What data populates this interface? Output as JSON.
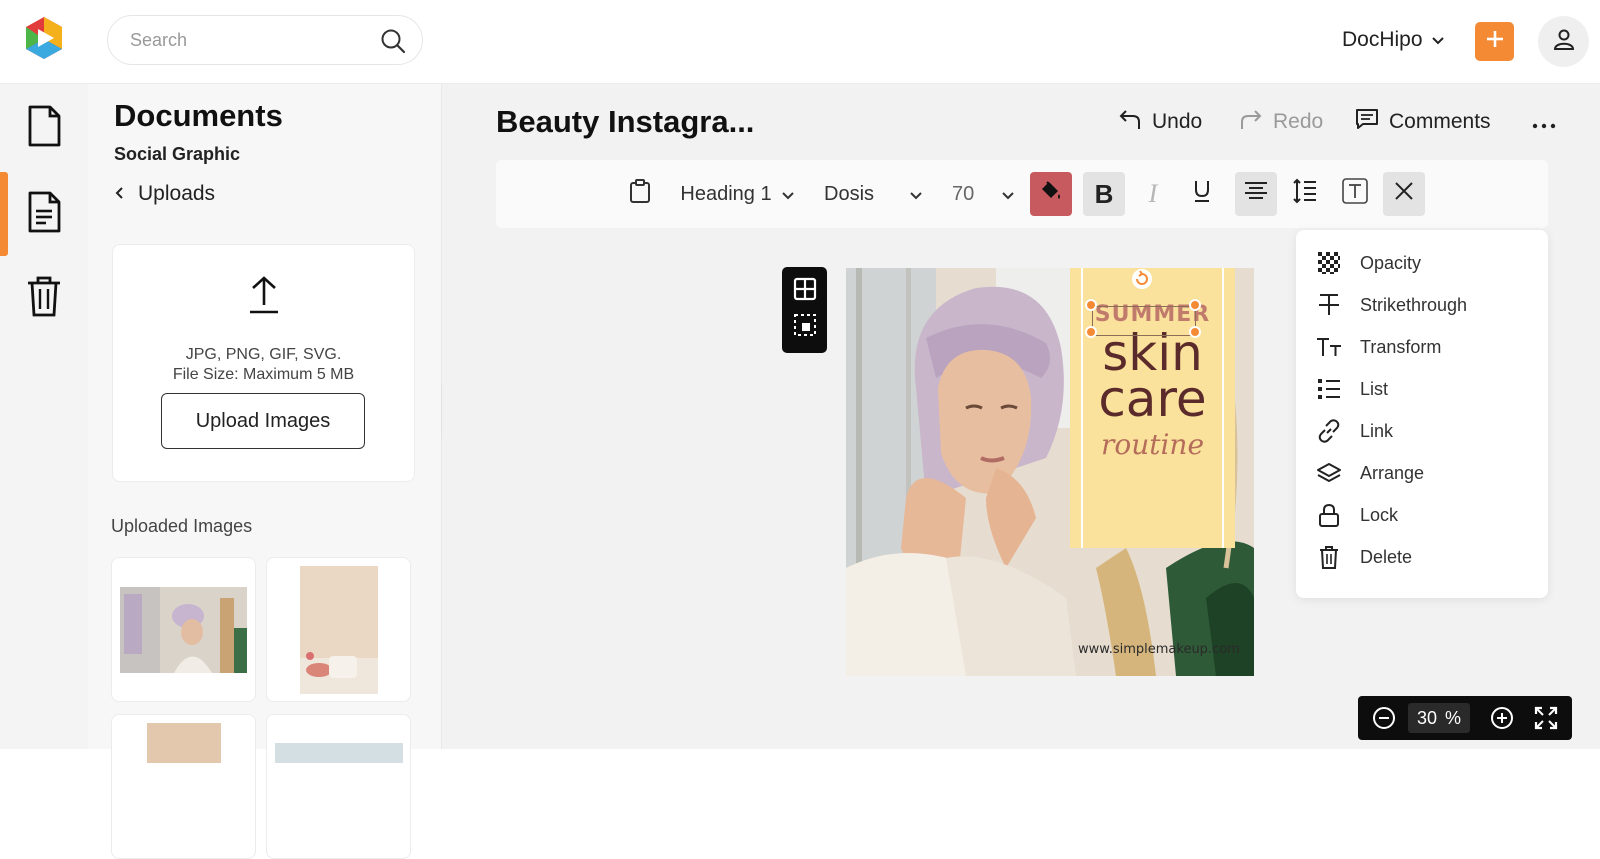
{
  "header": {
    "search_placeholder": "Search",
    "workspace_label": "DocHipo",
    "accent_color": "#f58a34"
  },
  "rail": {
    "items": [
      {
        "icon": "document-icon"
      },
      {
        "icon": "documents-list-icon",
        "active": true
      },
      {
        "icon": "trash-icon"
      }
    ]
  },
  "panel": {
    "title": "Documents",
    "subtitle": "Social Graphic",
    "back_label": "Uploads",
    "upload_formats": "JPG, PNG, GIF, SVG.",
    "upload_size": "File Size: Maximum 5 MB",
    "upload_button": "Upload Images",
    "uploaded_label": "Uploaded Images"
  },
  "editor": {
    "doc_title": "Beauty Instagra...",
    "undo_label": "Undo",
    "redo_label": "Redo",
    "comments_label": "Comments",
    "toolbar": {
      "text_style": "Heading 1",
      "font": "Dosis",
      "font_size": "70",
      "text_color": "#c75a5e"
    }
  },
  "design": {
    "line1": "SUMMER",
    "line2": "skin",
    "line3": "care",
    "line4": "routine",
    "website": "www.simplemakeup.com"
  },
  "context_menu": {
    "items": [
      {
        "label": "Opacity",
        "icon": "opacity-icon"
      },
      {
        "label": "Strikethrough",
        "icon": "strikethrough-icon"
      },
      {
        "label": "Transform",
        "icon": "transform-icon"
      },
      {
        "label": "List",
        "icon": "list-icon"
      },
      {
        "label": "Link",
        "icon": "link-icon"
      },
      {
        "label": "Arrange",
        "icon": "arrange-icon"
      },
      {
        "label": "Lock",
        "icon": "lock-icon"
      },
      {
        "label": "Delete",
        "icon": "delete-icon"
      }
    ]
  },
  "zoom": {
    "value": "30",
    "unit": "%"
  }
}
